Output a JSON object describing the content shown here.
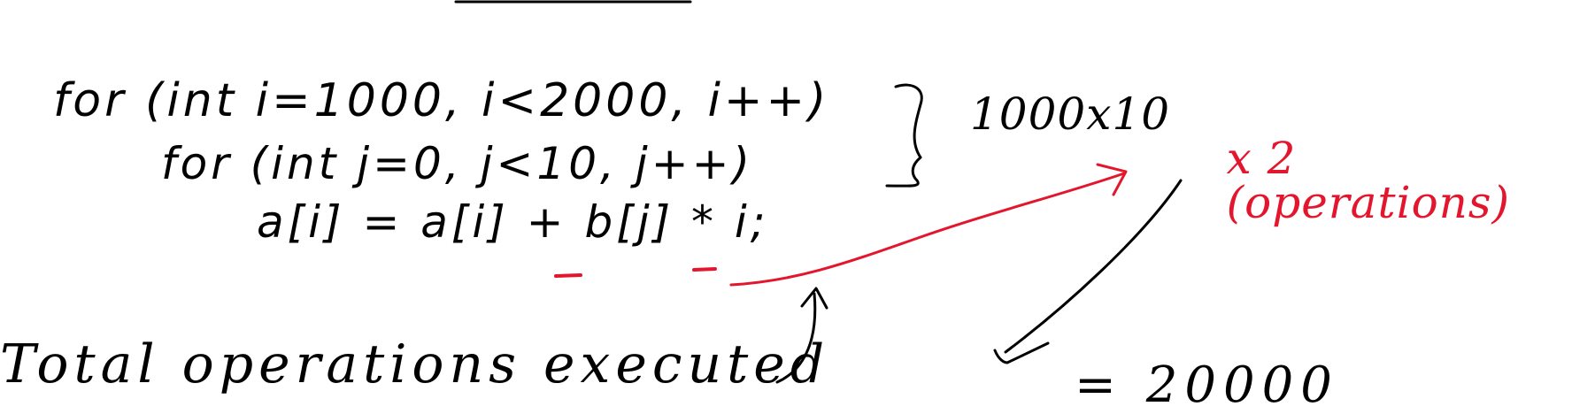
{
  "code": {
    "line1": "for (int i=1000, i<2000, i++)",
    "line2": "for (int j=0, j<10, j++)",
    "line3": "a[i] = a[i] + b[j] * i;"
  },
  "annotation": {
    "multiplication": "1000x10",
    "times_two": "x 2",
    "operations": "(operations)"
  },
  "caption": {
    "total": "Total operations executed"
  },
  "result": {
    "value": "= 20000"
  },
  "colors": {
    "ink": "#000000",
    "highlight": "#e3162d",
    "background": "#ffffff"
  }
}
